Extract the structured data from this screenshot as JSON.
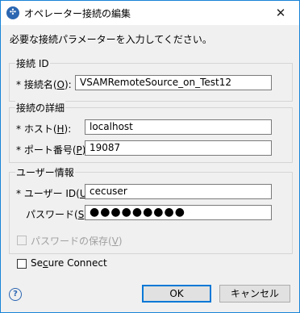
{
  "window": {
    "title": "オペレーター接続の編集",
    "close_glyph": "✕",
    "app_icon_glyph": "✣"
  },
  "instruction": "必要な接続パラメーターを入力してください。",
  "connection_id": {
    "group_title": "接続 ID",
    "name_label_pre": "* 接続名(",
    "name_label_key": "O",
    "name_label_post": "):",
    "name_value": "VSAMRemoteSource_on_Test12"
  },
  "connection_details": {
    "group_title": "接続の詳細",
    "host_label_pre": "* ホスト(",
    "host_label_key": "H",
    "host_label_post": "):",
    "host_value": "localhost",
    "port_label_pre": "* ポート番号(",
    "port_label_key": "P",
    "port_label_post": "):",
    "port_value": "19087"
  },
  "user_info": {
    "group_title": "ユーザー情報",
    "user_label_pre": "* ユーザー ID(",
    "user_label_key": "U",
    "user_label_post": "):",
    "user_value": "cecuser",
    "password_label_pre": "パスワード(",
    "password_label_key": "S",
    "password_label_post": "):",
    "password_mask": "●●●●●●●●●",
    "save_password_pre": "パスワードの保存(",
    "save_password_key": "V",
    "save_password_post": ")",
    "save_password_checked": false,
    "save_password_enabled": false
  },
  "secure_connect": {
    "label_pre": "Se",
    "label_key": "c",
    "label_post": "ure Connect",
    "checked": false
  },
  "buttons": {
    "ok": "OK",
    "cancel": "キャンセル"
  },
  "help_icon_glyph": "?"
}
